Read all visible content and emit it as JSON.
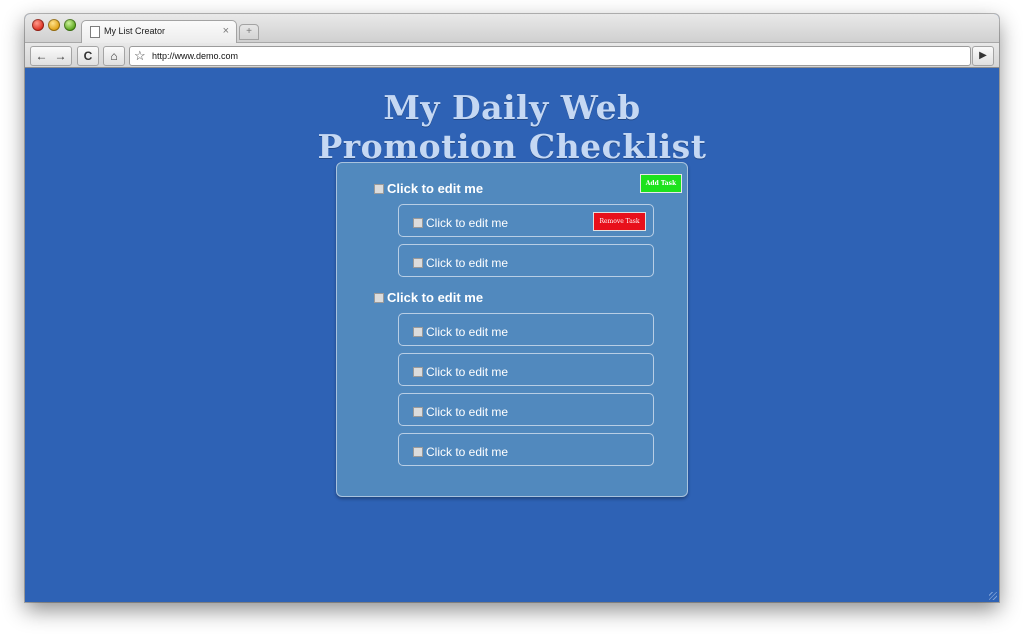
{
  "browser": {
    "tab_title": "My List Creator",
    "tab_close": "×",
    "new_tab": "+",
    "nav_back": "←",
    "nav_forward": "→",
    "reload": "C",
    "home": "⌂",
    "bookmark": "☆",
    "url": "http://www.demo.com",
    "go": "▶"
  },
  "page": {
    "title_line1": "My Daily Web",
    "title_line2": "Promotion Checklist",
    "add_task_label": "Add Task",
    "remove_task_label": "Remove Task",
    "groups": [
      {
        "label": "Click to edit me",
        "tasks": [
          "Click to edit me",
          "Click to edit me"
        ]
      },
      {
        "label": "Click to edit me",
        "tasks": [
          "Click to edit me",
          "Click to edit me",
          "Click to edit me",
          "Click to edit me"
        ]
      }
    ]
  },
  "colors": {
    "page_background": "#2e62b5",
    "panel_background": "#5189be",
    "add_button": "#1de21d",
    "remove_button": "#e8101b",
    "title_text": "#c5d8f3"
  }
}
